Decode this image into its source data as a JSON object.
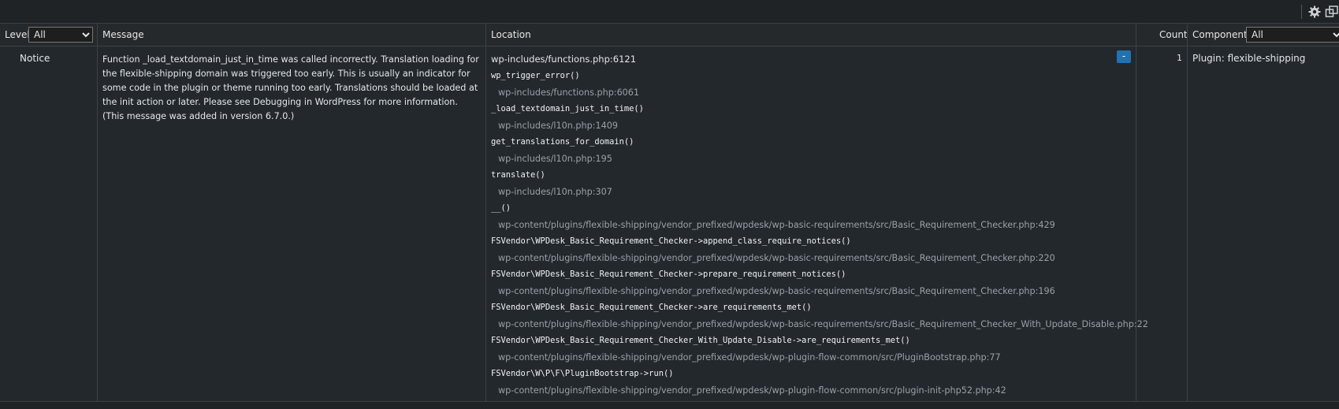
{
  "topbar": {
    "faint_text": "",
    "icons": [
      "gear-icon",
      "window-icon"
    ]
  },
  "columns": {
    "level": "Level",
    "message": "Message",
    "location": "Location",
    "count": "Count",
    "component": "Component"
  },
  "filters": {
    "level_selected": "All",
    "component_selected": "All"
  },
  "row": {
    "level": "Notice",
    "message": "Function _load_textdomain_just_in_time was called incorrectly. Translation loading for the flexible-shipping domain was triggered too early. This is usually an indicator for some code in the plugin or theme running too early. Translations should be loaded at the init action or later. Please see Debugging in WordPress for more information. (This message was added in version 6.7.0.)",
    "location_first": "wp-includes/functions.php:6121",
    "toggle_label": "-",
    "count": "1",
    "component": "Plugin: flexible-shipping",
    "trace": [
      {
        "type": "fn",
        "text": "wp_trigger_error()"
      },
      {
        "type": "path",
        "text": "wp-includes/functions.php:6061"
      },
      {
        "type": "fn",
        "text": "_load_textdomain_just_in_time()"
      },
      {
        "type": "path",
        "text": "wp-includes/l10n.php:1409"
      },
      {
        "type": "fn",
        "text": "get_translations_for_domain()"
      },
      {
        "type": "path",
        "text": "wp-includes/l10n.php:195"
      },
      {
        "type": "fn",
        "text": "translate()"
      },
      {
        "type": "path",
        "text": "wp-includes/l10n.php:307"
      },
      {
        "type": "fn",
        "text": "__()"
      },
      {
        "type": "path",
        "text": "wp-content/plugins/flexible-shipping/vendor_prefixed/wpdesk/wp-basic-requirements/src/Basic_Requirement_Checker.php:429"
      },
      {
        "type": "fn",
        "text": "FSVendor\\WPDesk_Basic_Requirement_Checker->append_class_require_notices()"
      },
      {
        "type": "path",
        "text": "wp-content/plugins/flexible-shipping/vendor_prefixed/wpdesk/wp-basic-requirements/src/Basic_Requirement_Checker.php:220"
      },
      {
        "type": "fn",
        "text": "FSVendor\\WPDesk_Basic_Requirement_Checker->prepare_requirement_notices()"
      },
      {
        "type": "path",
        "text": "wp-content/plugins/flexible-shipping/vendor_prefixed/wpdesk/wp-basic-requirements/src/Basic_Requirement_Checker.php:196"
      },
      {
        "type": "fn",
        "text": "FSVendor\\WPDesk_Basic_Requirement_Checker->are_requirements_met()"
      },
      {
        "type": "path",
        "text": "wp-content/plugins/flexible-shipping/vendor_prefixed/wpdesk/wp-basic-requirements/src/Basic_Requirement_Checker_With_Update_Disable.php:22"
      },
      {
        "type": "fn",
        "text": "FSVendor\\WPDesk_Basic_Requirement_Checker_With_Update_Disable->are_requirements_met()"
      },
      {
        "type": "path",
        "text": "wp-content/plugins/flexible-shipping/vendor_prefixed/wpdesk/wp-plugin-flow-common/src/PluginBootstrap.php:77"
      },
      {
        "type": "fn",
        "text": "FSVendor\\W\\P\\F\\PluginBootstrap->run()"
      },
      {
        "type": "path",
        "text": "wp-content/plugins/flexible-shipping/vendor_prefixed/wpdesk/wp-plugin-flow-common/src/plugin-init-php52.php:42"
      }
    ]
  },
  "colors": {
    "background": "#23282d",
    "header": "#26292c",
    "border": "#3b4147",
    "toggle": "#2271b1",
    "path_text": "#9aa0a6"
  }
}
